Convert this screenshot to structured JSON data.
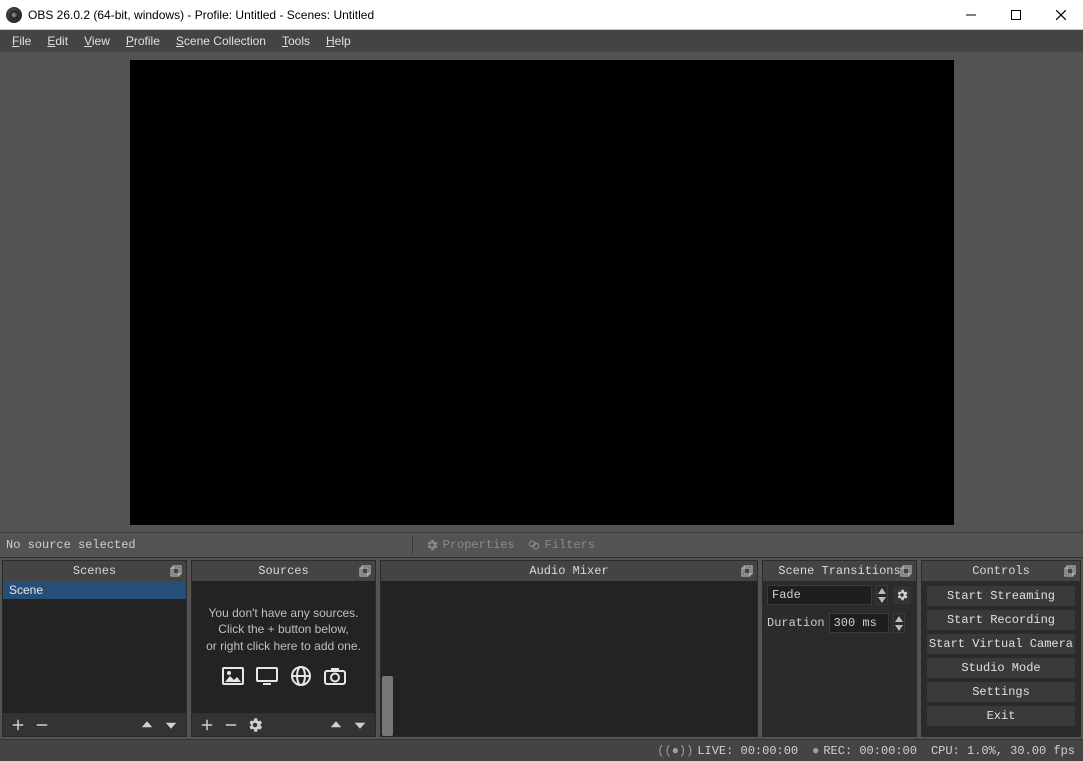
{
  "title": "OBS 26.0.2 (64-bit, windows) - Profile: Untitled - Scenes: Untitled",
  "menu": {
    "file": "File",
    "edit": "Edit",
    "view": "View",
    "profile": "Profile",
    "scene_collection": "Scene Collection",
    "tools": "Tools",
    "help": "Help"
  },
  "mid": {
    "no_source": "No source selected",
    "properties": "Properties",
    "filters": "Filters"
  },
  "docks": {
    "scenes": {
      "title": "Scenes",
      "items": [
        "Scene"
      ]
    },
    "sources": {
      "title": "Sources",
      "empty1": "You don't have any sources.",
      "empty2": "Click the + button below,",
      "empty3": "or right click here to add one."
    },
    "mixer": {
      "title": "Audio Mixer"
    },
    "transitions": {
      "title": "Scene Transitions",
      "selected": "Fade",
      "duration_label": "Duration",
      "duration_value": "300 ms"
    },
    "controls": {
      "title": "Controls",
      "start_streaming": "Start Streaming",
      "start_recording": "Start Recording",
      "start_vcam": "Start Virtual Camera",
      "studio_mode": "Studio Mode",
      "settings": "Settings",
      "exit": "Exit"
    }
  },
  "status": {
    "live": "LIVE: 00:00:00",
    "rec": "REC: 00:00:00",
    "cpu": "CPU: 1.0%, 30.00 fps"
  }
}
